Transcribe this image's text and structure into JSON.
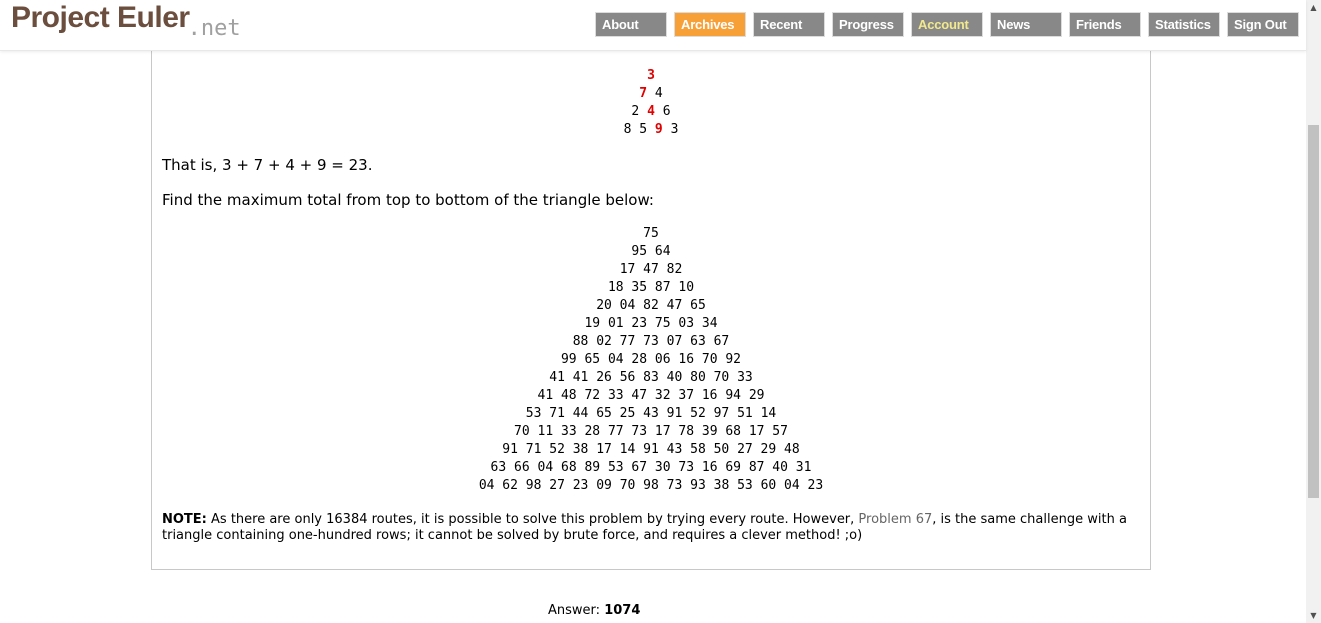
{
  "logo": {
    "main": "Project Euler",
    "suffix": ".net"
  },
  "nav": [
    {
      "label": "About",
      "name": "nav-about"
    },
    {
      "label": "Archives",
      "name": "nav-archives"
    },
    {
      "label": "Recent",
      "name": "nav-recent"
    },
    {
      "label": "Progress",
      "name": "nav-progress"
    },
    {
      "label": "Account",
      "name": "nav-account"
    },
    {
      "label": "News",
      "name": "nav-news"
    },
    {
      "label": "Friends",
      "name": "nav-friends"
    },
    {
      "label": "Statistics",
      "name": "nav-statistics"
    },
    {
      "label": "Sign Out",
      "name": "nav-sign-out"
    }
  ],
  "colors": {
    "nav_button": "#888888",
    "nav_active": "#f7a038",
    "account_text": "#f1e98c",
    "logo": "#6b4e3d",
    "highlight": "#e00000",
    "link": "#666666"
  },
  "example": {
    "rows": [
      [
        {
          "v": "3",
          "hl": true
        }
      ],
      [
        {
          "v": "7",
          "hl": true
        },
        {
          "v": "4",
          "hl": false
        }
      ],
      [
        {
          "v": "2",
          "hl": false
        },
        {
          "v": "4",
          "hl": true
        },
        {
          "v": "6",
          "hl": false
        }
      ],
      [
        {
          "v": "8",
          "hl": false
        },
        {
          "v": "5",
          "hl": false
        },
        {
          "v": "9",
          "hl": true
        },
        {
          "v": "3",
          "hl": false
        }
      ]
    ],
    "summary": "That is, 3 + 7 + 4 + 9 = 23."
  },
  "prompt": "Find the maximum total from top to bottom of the triangle below:",
  "triangle": [
    "75",
    "95 64",
    "17 47 82",
    "18 35 87 10",
    "20 04 82 47 65",
    "19 01 23 75 03 34",
    "88 02 77 73 07 63 67",
    "99 65 04 28 06 16 70 92",
    "41 41 26 56 83 40 80 70 33",
    "41 48 72 33 47 32 37 16 94 29",
    "53 71 44 65 25 43 91 52 97 51 14",
    "70 11 33 28 77 73 17 78 39 68 17 57",
    "91 71 52 38 17 14 91 43 58 50 27 29 48",
    "63 66 04 68 89 53 67 30 73 16 69 87 40 31",
    "04 62 98 27 23 09 70 98 73 93 38 53 60 04 23"
  ],
  "note": {
    "label": "NOTE:",
    "before": " As there are only 16384 routes, it is possible to solve this problem by trying every route. However, ",
    "link": "Problem 67",
    "after": ", is the same challenge with a triangle containing one-hundred rows; it cannot be solved by brute force, and requires a clever method! ;o)"
  },
  "answer": {
    "label": "Answer:",
    "value": "1074"
  },
  "scrollbar": {
    "up_icon": "arrow-up-icon",
    "down_icon": "arrow-down-icon"
  }
}
